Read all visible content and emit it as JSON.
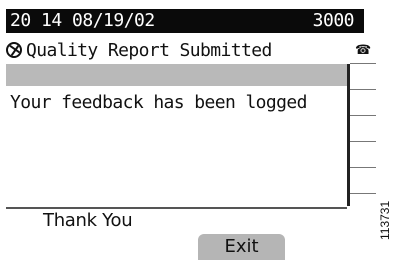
{
  "status_bar": {
    "datetime": "20 14 08/19/02",
    "extension": "3000"
  },
  "screen": {
    "title": "Quality Report Submitted",
    "title_icon": "globe-icon",
    "message": "Your feedback has been logged",
    "line_key_icon": "phone-icon",
    "phone_glyph": "☎"
  },
  "prompt": "Thank You",
  "softkeys": [
    {
      "label": "Exit"
    }
  ],
  "figure_id": "113731"
}
